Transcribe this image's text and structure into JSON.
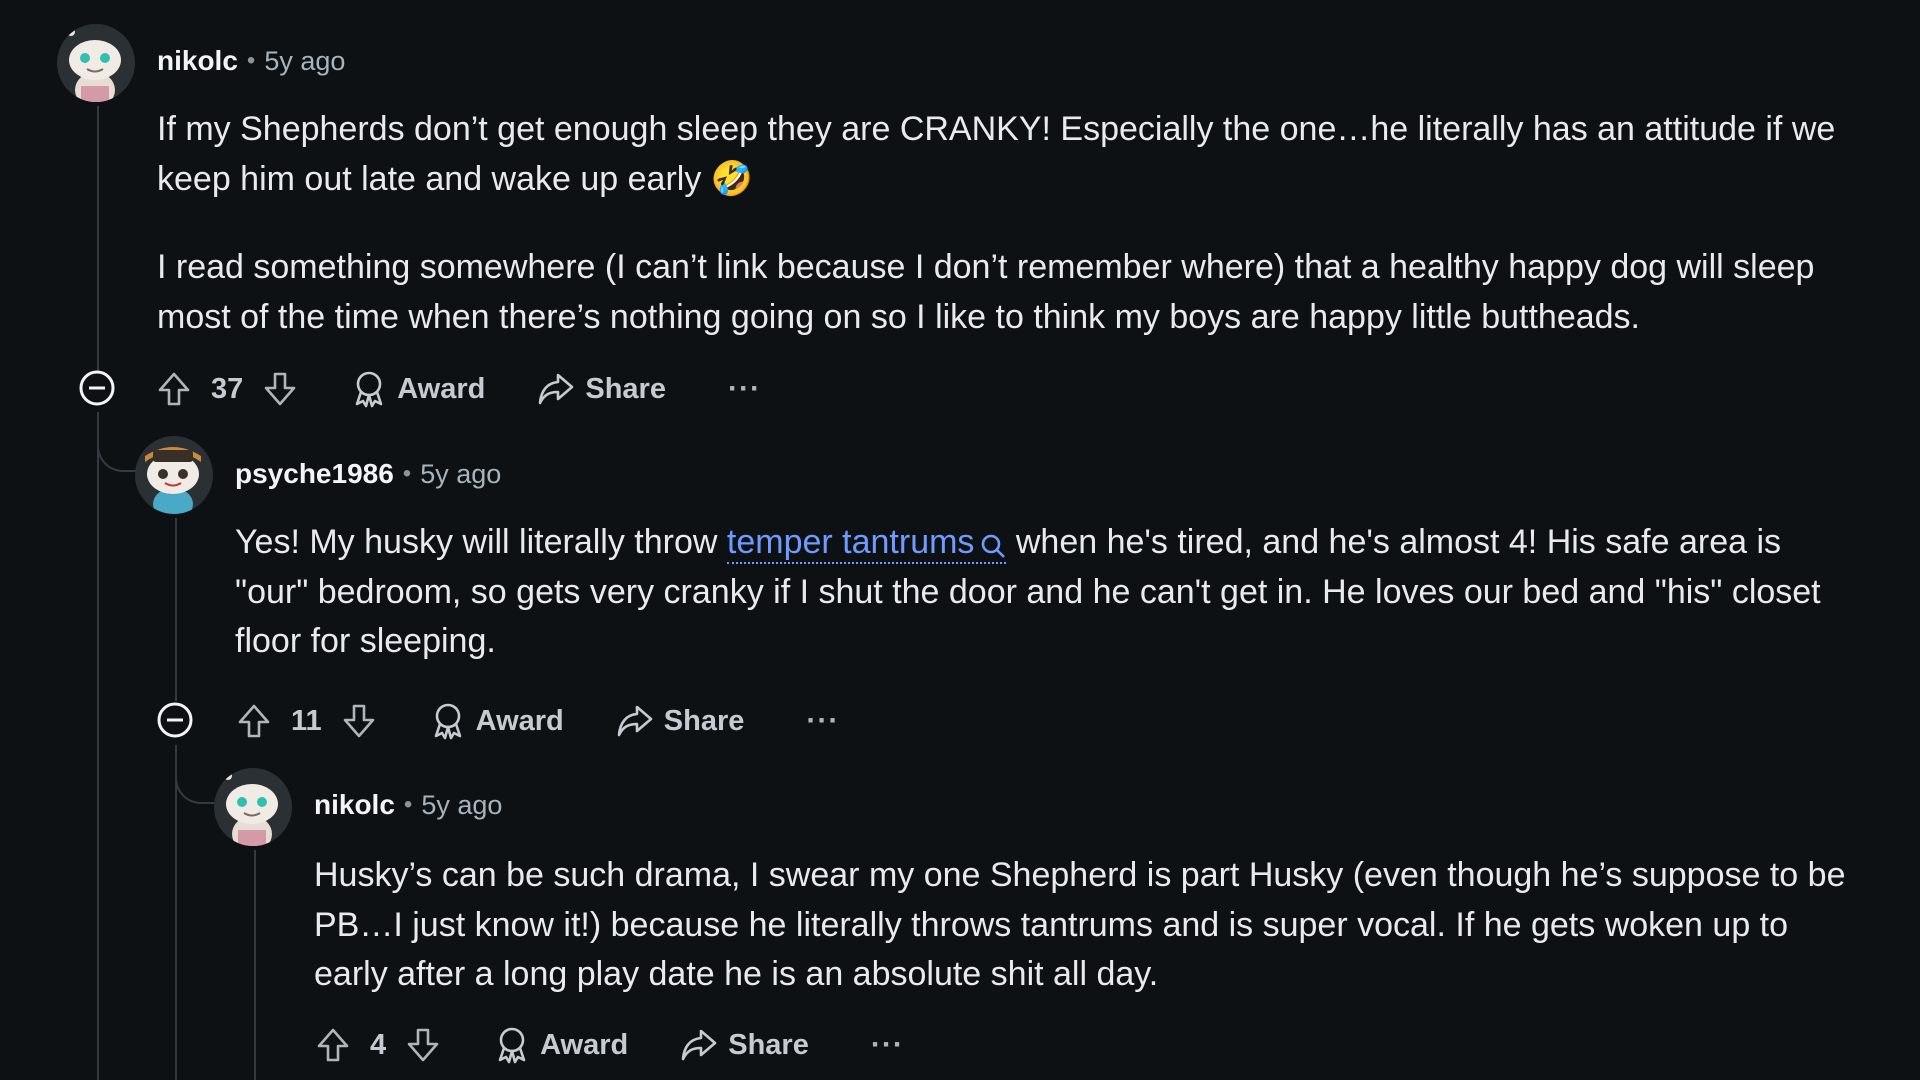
{
  "comments": [
    {
      "author": "nikolc",
      "separator": "•",
      "time": "5y ago",
      "avatar_icon": "snoo-avatar-icon",
      "paragraphs": [
        "If my Shepherds don’t get enough sleep they are CRANKY! Especially the one…he literally has an attitude if we keep him out late and wake up early",
        "I read something somewhere (I can’t link because I don’t remember where) that a healthy happy dog will sleep most of the time when there’s nothing going on so I like to think my boys are happy little buttheads."
      ],
      "emoji": "🤣",
      "score": "37",
      "award_label": "Award",
      "share_label": "Share",
      "more_label": "···"
    },
    {
      "author": "psyche1986",
      "separator": "•",
      "time": "5y ago",
      "avatar_icon": "snoo-avatar-icon",
      "text_before": "Yes! My husky will literally throw ",
      "link_text": "temper tantrums",
      "link_icon": "search-icon",
      "text_after": " when he's tired, and he's almost 4! His safe area is \"our\" bedroom, so gets very cranky if I shut the door and he can't get in. He loves our bed and \"his\" closet floor for sleeping.",
      "score": "11",
      "award_label": "Award",
      "share_label": "Share",
      "more_label": "···"
    },
    {
      "author": "nikolc",
      "separator": "•",
      "time": "5y ago",
      "avatar_icon": "snoo-avatar-icon",
      "paragraphs": [
        "Husky’s can be such drama, I swear my one Shepherd is part Husky (even though he’s suppose to be PB…I just know it!) because he literally throws tantrums and is super vocal. If he gets woken up to early after a long play date he is an absolute shit all day."
      ],
      "score": "4",
      "award_label": "Award",
      "share_label": "Share",
      "more_label": "···"
    }
  ],
  "colors": {
    "background": "#0e1113",
    "text": "#e8eaed",
    "muted": "#a8b3bb",
    "link": "#6e9bff",
    "thread_line": "#343b40"
  }
}
